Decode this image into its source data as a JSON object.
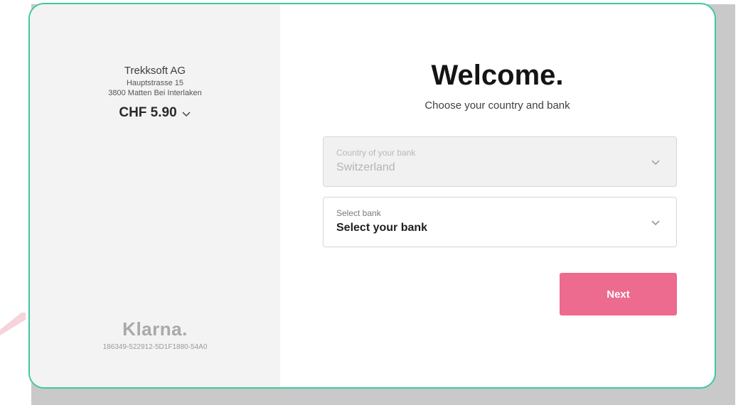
{
  "merchant": {
    "name": "Trekksoft AG",
    "street": "Hauptstrasse 15",
    "city": "3800 Matten Bei Interlaken",
    "amount": "CHF 5.90"
  },
  "brand": {
    "logo_text": "Klarna.",
    "reference_id": "186349-522912-5D1F1880-54A0"
  },
  "main": {
    "title": "Welcome.",
    "subtitle": "Choose your country and bank",
    "country_select": {
      "label": "Country of your bank",
      "value": "Switzerland"
    },
    "bank_select": {
      "label": "Select bank",
      "value": "Select your bank"
    },
    "next_label": "Next"
  },
  "colors": {
    "border_accent": "#3fc7a3",
    "button": "#ec6b8f",
    "left_panel_bg": "#f3f3f3"
  }
}
